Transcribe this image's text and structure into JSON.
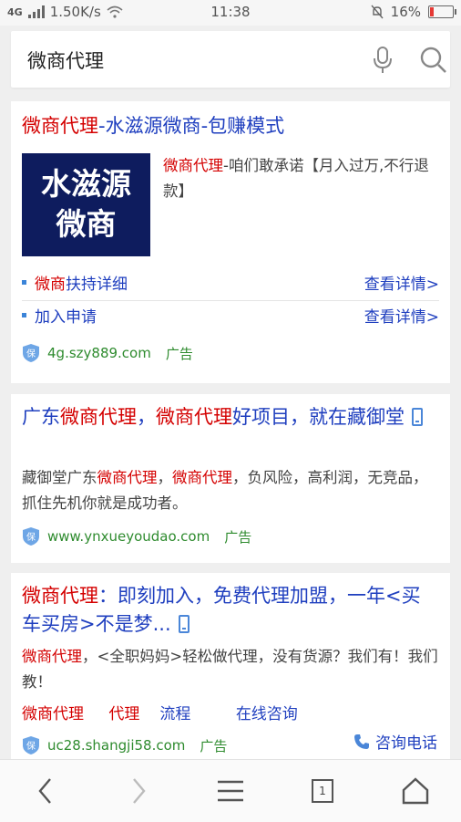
{
  "status_bar": {
    "network": "4G",
    "speed": "1.50K/s",
    "time": "11:38",
    "battery": "16%",
    "battery_level": 0.16,
    "battery_color": "#e53935"
  },
  "search": {
    "value": "微商代理"
  },
  "results": [
    {
      "title_red": "微商代理",
      "title_rest": "-水滋源微商-包赚模式",
      "image_text_line1": "水滋源",
      "image_text_line2": "微商",
      "desc_red": "微商代理",
      "desc_rest": "-咱们敢承诺【月入过万,不行退款】",
      "sitelinks": [
        {
          "left_red": "微商",
          "left_rest": "扶持详细",
          "right": "查看详情>"
        },
        {
          "left_red": "",
          "left_rest": "加入申请",
          "right": "查看详情>"
        }
      ],
      "url": "4g.szy889.com",
      "ad": "广告"
    },
    {
      "title_part1": "广东",
      "title_red1": "微商代理",
      "title_part2": "，",
      "title_red2": "微商代理",
      "title_part3": "好项目，就在藏御堂",
      "desc_part1": "藏御堂广东",
      "desc_red1": "微商代理",
      "desc_part2": "，",
      "desc_red2": "微商代理",
      "desc_part3": "，负风险，高利润，无竞品，抓住先机你就是成功者。",
      "url": "www.ynxueyoudao.com",
      "ad": "广告"
    },
    {
      "title_red": "微商代理",
      "title_rest": "：即刻加入，免费代理加盟，一年<买车买房>不是梦...",
      "desc_red": "微商代理",
      "desc_rest": "，<全职妈妈>轻松做代理，没有货源？我们有！我们教！",
      "link1": "微商代理",
      "link2_red": "代理",
      "link2_rest": "流程",
      "link3": "在线咨询",
      "url": "uc28.shangji58.com",
      "ad": "广告",
      "consult": "咨询电话"
    }
  ],
  "bottom_nav": {
    "tab_count": "1"
  },
  "colors": {
    "link_blue": "#1f3fbf",
    "keyword_red": "#d40000",
    "url_green": "#2e8b2e",
    "brand_navy": "#0e1c5e"
  }
}
